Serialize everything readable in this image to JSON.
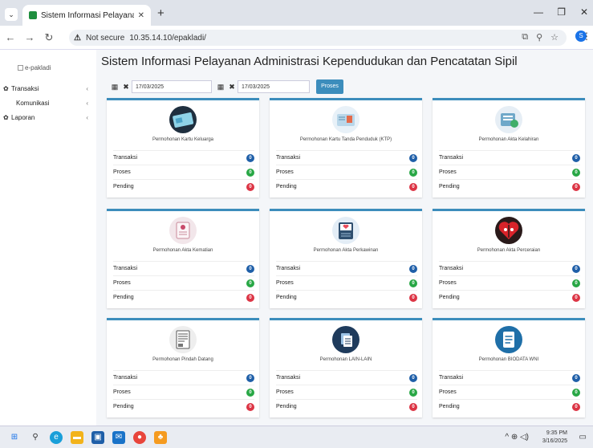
{
  "browser": {
    "tab_title": "Sistem Informasi Pelayanan Ad",
    "url_security": "Not secure",
    "url": "10.35.14.10/epakladi/",
    "profile_initial": "S"
  },
  "sidebar": {
    "logo_alt": "e-pakladi",
    "items": [
      {
        "label": "Transaksi",
        "icon": "gear-icon"
      },
      {
        "label": "Komunikasi",
        "icon": ""
      },
      {
        "label": "Laporan",
        "icon": "gear-icon"
      }
    ]
  },
  "main": {
    "title": "Sistem Informasi Pelayanan Administrasi Kependudukan dan Pencatatan Sipil",
    "date_from": "17/03/2025",
    "date_to": "17/03/2025",
    "proses_label": "Proses"
  },
  "row_labels": {
    "transaksi": "Transaksi",
    "proses": "Proses",
    "pending": "Pending"
  },
  "cards": [
    {
      "title": "Permohonan Kartu Keluarga",
      "icon": "family-card-icon",
      "transaksi": "0",
      "proses": "0",
      "pending": "0"
    },
    {
      "title": "Permohonan Kartu Tanda Penduduk (KTP)",
      "icon": "id-card-icon",
      "transaksi": "0",
      "proses": "0",
      "pending": "0"
    },
    {
      "title": "Permohonan Akta Kelahiran",
      "icon": "birth-certificate-icon",
      "transaksi": "0",
      "proses": "0",
      "pending": "0"
    },
    {
      "title": "Permohonan Akta Kematian",
      "icon": "death-certificate-icon",
      "transaksi": "0",
      "proses": "0",
      "pending": "0"
    },
    {
      "title": "Permohonan Akta Perkawinan",
      "icon": "marriage-certificate-icon",
      "transaksi": "0",
      "proses": "0",
      "pending": "0"
    },
    {
      "title": "Permohonan Akta Perceraian",
      "icon": "divorce-heart-icon",
      "transaksi": "0",
      "proses": "0",
      "pending": "0"
    },
    {
      "title": "Permohonan Pindah Datang",
      "icon": "moving-document-icon",
      "transaksi": "0",
      "proses": "0",
      "pending": "0"
    },
    {
      "title": "Permohonan LAIN-LAIN",
      "icon": "documents-icon",
      "transaksi": "0",
      "proses": "0",
      "pending": "0"
    },
    {
      "title": "Permohonan BIODATA WNI",
      "icon": "biodata-document-icon",
      "transaksi": "0",
      "proses": "0",
      "pending": "0"
    }
  ],
  "taskbar": {
    "time": "9:35 PM",
    "date": "3/16/2025"
  },
  "colors": {
    "accent": "#3c8dbc",
    "badge_transaksi": "#1f5fa8",
    "badge_proses": "#28a745",
    "badge_pending": "#dc3545"
  }
}
